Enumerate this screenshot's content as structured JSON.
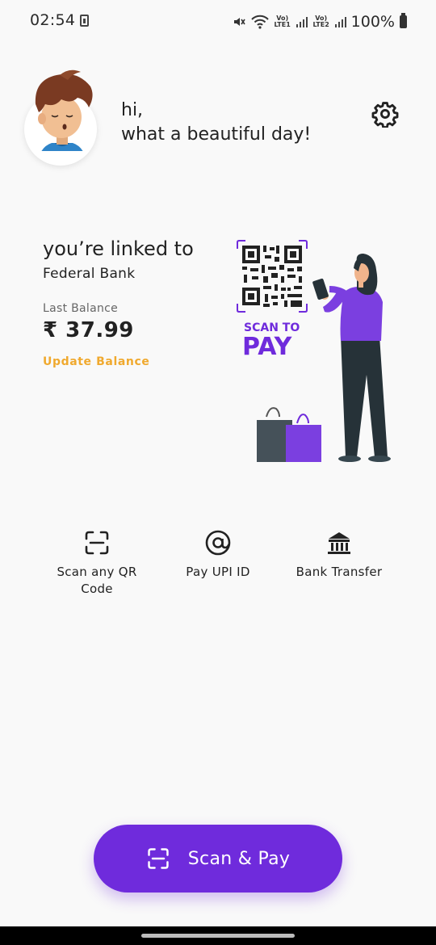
{
  "status_bar": {
    "time": "02:54",
    "lte1": "Vo) LTE1",
    "lte2": "Vo) LTE2",
    "battery": "100%"
  },
  "header": {
    "greeting_line1": "hi,",
    "greeting_line2": "what a beautiful day!",
    "settings_icon": "gear-icon"
  },
  "account": {
    "linked_text": "you’re linked to",
    "bank_name": "Federal Bank",
    "balance_label": "Last Balance",
    "balance_value": "₹ 37.99",
    "update_label": "Update Balance"
  },
  "illustration": {
    "scan_text": "SCAN TO",
    "pay_text": "PAY"
  },
  "actions": [
    {
      "label": "Scan any QR Code",
      "icon": "scan-icon"
    },
    {
      "label": "Pay UPI ID",
      "icon": "at-icon"
    },
    {
      "label": "Bank Transfer",
      "icon": "bank-icon"
    }
  ],
  "cta": {
    "label": "Scan & Pay",
    "icon": "scan-icon"
  },
  "colors": {
    "primary": "#6f2bdc",
    "accent": "#f0a92e",
    "background": "#f9f9f9"
  }
}
